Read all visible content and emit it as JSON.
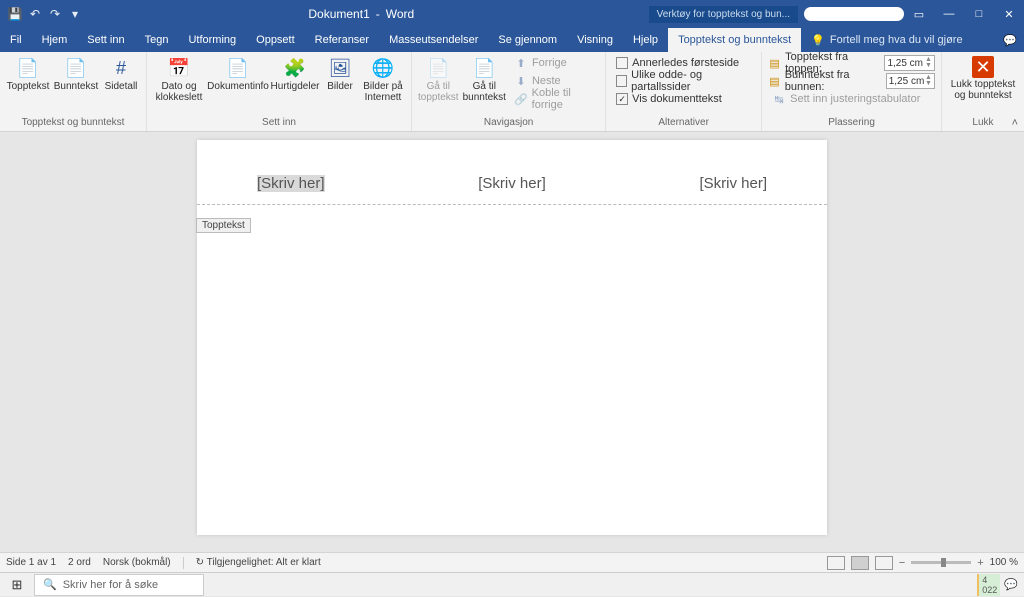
{
  "title": {
    "doc": "Dokument1",
    "app": "Word",
    "context_tool": "Verktøy for topptekst og bun..."
  },
  "tabs": {
    "file": "Fil",
    "home": "Hjem",
    "insert": "Sett inn",
    "draw": "Tegn",
    "design": "Utforming",
    "layout": "Oppsett",
    "references": "Referanser",
    "mailings": "Masseutsendelser",
    "review": "Se gjennom",
    "view": "Visning",
    "help": "Hjelp",
    "hf": "Topptekst og bunntekst",
    "tell_me": "Fortell meg hva du vil gjøre"
  },
  "ribbon": {
    "g1": {
      "header": "Topptekst",
      "footer": "Bunntekst",
      "pagenum": "Sidetall",
      "label": "Topptekst og bunntekst"
    },
    "g2": {
      "datetime": "Dato og klokkeslett",
      "docinfo": "Dokumentinfo",
      "quickparts": "Hurtigdeler",
      "pictures": "Bilder",
      "online_pictures": "Bilder på Internett",
      "label": "Sett inn"
    },
    "g3": {
      "goto_header": "Gå til topptekst",
      "goto_footer": "Gå til bunntekst",
      "previous": "Forrige",
      "next": "Neste",
      "link": "Koble til forrige",
      "label": "Navigasjon"
    },
    "g4": {
      "diff_first": "Annerledes førsteside",
      "diff_odd_even": "Ulike odde- og partallssider",
      "show_doc": "Vis dokumenttekst",
      "label": "Alternativer"
    },
    "g5": {
      "from_top": "Topptekst fra toppen:",
      "from_bottom": "Bunntekst fra bunnen:",
      "value": "1,25 cm",
      "align_tab": "Sett inn justeringstabulator",
      "label": "Plassering"
    },
    "g6": {
      "close": "Lukk topptekst og bunntekst",
      "label": "Lukk"
    }
  },
  "doc": {
    "placeholder": "[Skriv her]",
    "header_tag": "Topptekst"
  },
  "status": {
    "page": "Side 1 av 1",
    "words": "2 ord",
    "lang": "Norsk (bokmål)",
    "access": "Tilgjengelighet: Alt er klart",
    "zoom": "100 %"
  },
  "taskbar": {
    "search": "Skriv her for å søke",
    "year": "022",
    "num": "4"
  }
}
